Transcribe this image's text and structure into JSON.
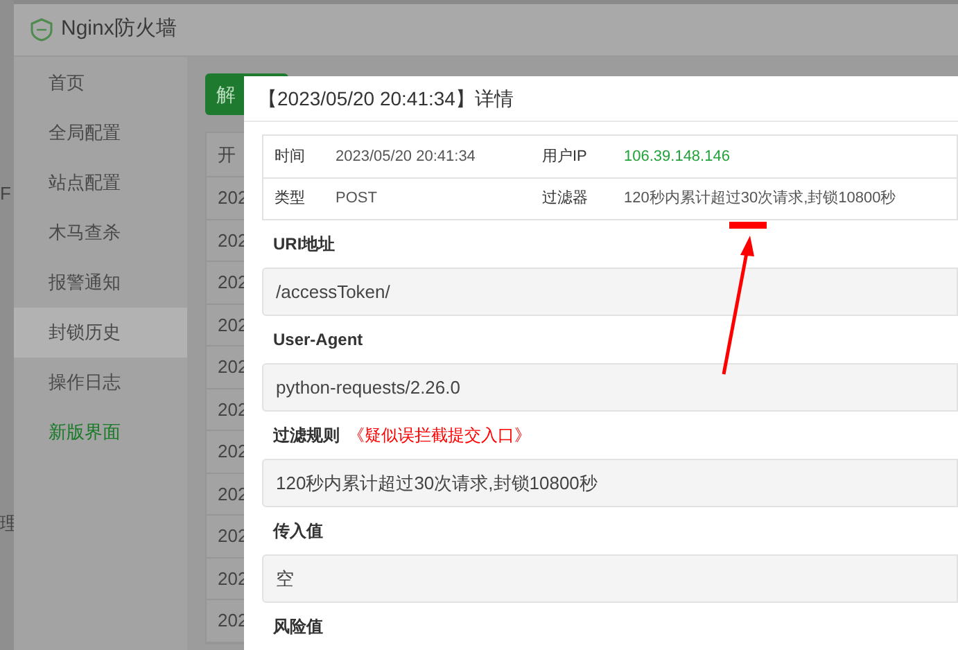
{
  "background_fragments": [
    "F",
    "理"
  ],
  "window": {
    "title": "Nginx防火墙"
  },
  "sidebar": {
    "items": [
      {
        "label": "首页",
        "selected": false,
        "kind": "normal"
      },
      {
        "label": "全局配置",
        "selected": false,
        "kind": "normal"
      },
      {
        "label": "站点配置",
        "selected": false,
        "kind": "normal"
      },
      {
        "label": "木马查杀",
        "selected": false,
        "kind": "normal"
      },
      {
        "label": "报警通知",
        "selected": false,
        "kind": "normal"
      },
      {
        "label": "封锁历史",
        "selected": true,
        "kind": "normal"
      },
      {
        "label": "操作日志",
        "selected": false,
        "kind": "normal"
      },
      {
        "label": "新版界面",
        "selected": false,
        "kind": "highlight"
      }
    ]
  },
  "toolbar": {
    "button": "解"
  },
  "table": {
    "column_1": "开",
    "rows": [
      "202",
      "202",
      "202",
      "202",
      "202",
      "202",
      "202",
      "202",
      "202",
      "202",
      "202"
    ]
  },
  "dialog": {
    "title": "【2023/05/20 20:41:34】详情",
    "info": [
      [
        {
          "label": "时间",
          "value": "2023/05/20 20:41:34",
          "kind": "plain"
        },
        {
          "label": "用户IP",
          "value": "106.39.148.146",
          "kind": "ip"
        }
      ],
      [
        {
          "label": "类型",
          "value": "POST",
          "kind": "plain"
        },
        {
          "label": "过滤器",
          "value": "120秒内累计超过30次请求,封锁10800秒",
          "kind": "plain"
        }
      ]
    ],
    "sections": [
      {
        "label": "URI地址",
        "value": "/accessToken/"
      },
      {
        "label": "User-Agent",
        "value": "python-requests/2.26.0"
      },
      {
        "label": "过滤规则",
        "link": "《疑似误拦截提交入口》",
        "value": "120秒内累计超过30次请求,封锁10800秒"
      },
      {
        "label": "传入值",
        "value": "空"
      },
      {
        "label": "风险值"
      }
    ]
  }
}
